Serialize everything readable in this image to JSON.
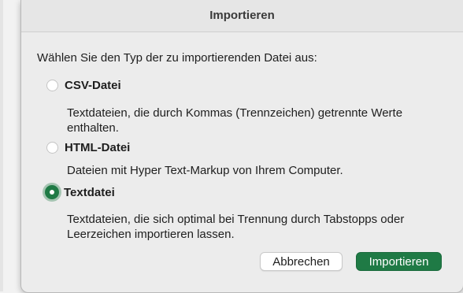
{
  "dialog": {
    "title": "Importieren",
    "prompt": "Wählen Sie den Typ der zu importierenden Datei aus:",
    "options": [
      {
        "label": "CSV-Datei",
        "description": "Textdateien, die durch Kommas (Trennzeichen) getrennte Werte enthalten.",
        "selected": false
      },
      {
        "label": "HTML-Datei",
        "description": "Dateien mit Hyper Text-Markup von Ihrem Computer.",
        "selected": false
      },
      {
        "label": "Textdatei",
        "description": "Textdateien, die sich optimal bei Trennung durch Tabstopps oder Leerzeichen importieren lassen.",
        "selected": true
      }
    ],
    "buttons": {
      "cancel_label": "Abbrechen",
      "import_label": "Importieren"
    }
  },
  "colors": {
    "accent": "#1f7a45",
    "dialog_background": "#ececec"
  }
}
